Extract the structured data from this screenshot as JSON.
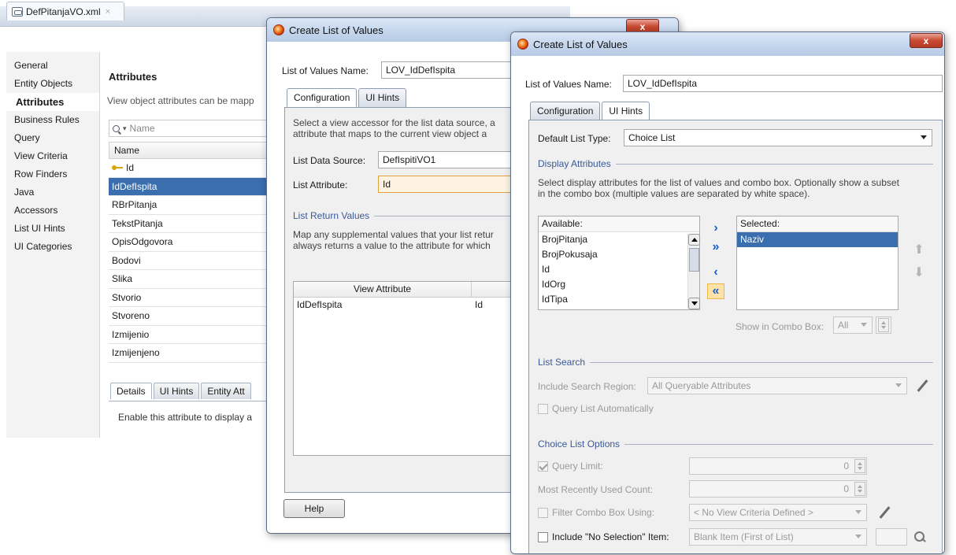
{
  "editor": {
    "tab_label": "DefPitanjaVO.xml",
    "tab_close": "×",
    "nav": [
      {
        "label": "General"
      },
      {
        "label": "Entity Objects"
      },
      {
        "label": "Attributes"
      },
      {
        "label": "Business Rules"
      },
      {
        "label": "Query"
      },
      {
        "label": "View Criteria"
      },
      {
        "label": "Row Finders"
      },
      {
        "label": "Java"
      },
      {
        "label": "Accessors"
      },
      {
        "label": "List UI Hints"
      },
      {
        "label": "UI Categories"
      }
    ],
    "title": "Attributes",
    "description": "View object attributes can be mapp",
    "search_placeholder": "Name",
    "column_header": "Name",
    "rows": [
      "Id",
      "IdDefIspita",
      "RBrPitanja",
      "TekstPitanja",
      "OpisOdgovora",
      "Bodovi",
      "Slika",
      "Stvorio",
      "Stvoreno",
      "Izmijenio",
      "Izmijenjeno"
    ],
    "subtabs": [
      "Details",
      "UI Hints",
      "Entity Att"
    ],
    "enable_text": "Enable this attribute to display a"
  },
  "dialog1": {
    "title": "Create List of Values",
    "close": "x",
    "lov_name_label": "List of Values Name:",
    "lov_name_underline": "N",
    "lov_name_value": "LOV_IdDefIspita",
    "tabs": [
      "Configuration",
      "UI Hints"
    ],
    "desc1": "Select a view accessor for the list data source, a",
    "desc2": "attribute that maps to the current view object a",
    "data_source_label": "List Data Source:",
    "data_source_value": "DefIspitiVO1",
    "attribute_label": "List Attribute:",
    "attribute_value": "Id",
    "return_values_section": "List Return Values",
    "return_desc1": "Map any supplemental values that your list retur",
    "return_desc2": "always returns a value to the attribute for which",
    "table_header_view": "View Attribute",
    "table_row_view": "IdDefIspita",
    "table_row_list": "Id",
    "help_label": "Help"
  },
  "dialog2": {
    "title": "Create List of Values",
    "close": "x",
    "lov_name_label": "List of Values Name:",
    "lov_name_value": "LOV_IdDefIspita",
    "tabs": [
      "Configuration",
      "UI Hints"
    ],
    "default_list_type_label": "Default List Type:",
    "default_list_type_value": "Choice List",
    "display_attributes_section": "Display Attributes",
    "display_desc1": "Select display attributes for the list of values and combo box. Optionally show a subset",
    "display_desc2": "in the combo box (multiple values are separated by white space).",
    "available_label": "Available:",
    "available_items": [
      "BrojPitanja",
      "BrojPokusaja",
      "Id",
      "IdOrg",
      "IdTipa"
    ],
    "selected_label": "Selected:",
    "selected_items": [
      "Naziv"
    ],
    "shuttle_icons": [
      "move-right",
      "move-all-right",
      "move-left",
      "move-all-left"
    ],
    "show_in_combo_label": "Show in Combo Box:",
    "show_in_combo_value": "All",
    "list_search_section": "List Search",
    "include_search_region_label": "Include Search Region:",
    "include_search_region_value": "All Queryable Attributes",
    "query_list_auto_label": "Query List Automatically",
    "choice_list_options_section": "Choice List Options",
    "query_limit_label": "Query Limit:",
    "query_limit_value": "0",
    "mru_count_label": "Most Recently Used Count:",
    "mru_count_value": "0",
    "filter_combo_label": "Filter Combo Box Using:",
    "filter_combo_value": "< No View Criteria Defined >",
    "include_no_selection_label": "Include \"No Selection\" Item:",
    "include_no_selection_value": "Blank Item (First of List)"
  }
}
